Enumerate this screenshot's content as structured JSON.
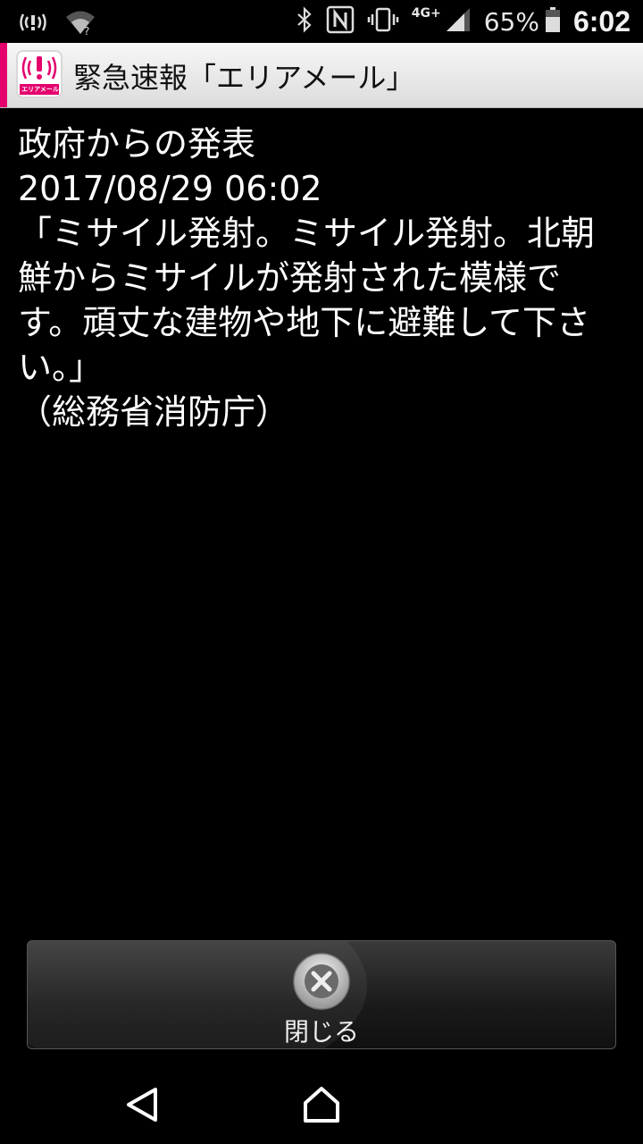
{
  "status_bar": {
    "network_type": "4G+",
    "battery_percent": "65%",
    "time": "6:02"
  },
  "app_header": {
    "title": "緊急速報「エリアメール」",
    "icon_label": "エリアメール",
    "accent_color": "#e4006d"
  },
  "message": {
    "sender": "政府からの発表",
    "timestamp": "2017/08/29 06:02",
    "body": "「ミサイル発射。ミサイル発射。北朝鮮からミサイルが発射された模様です。頑丈な建物や地下に避難して下さい。」",
    "agency": "（総務省消防庁）"
  },
  "close_button": {
    "label": "閉じる",
    "icon": "close-circle-icon"
  },
  "nav_bar": {
    "back_icon": "back-icon",
    "home_icon": "home-icon"
  }
}
